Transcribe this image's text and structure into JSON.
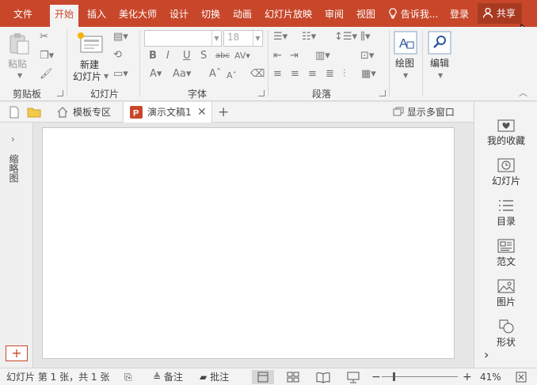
{
  "menu": {
    "items": [
      "文件",
      "开始",
      "插入",
      "美化大师",
      "设计",
      "切换",
      "动画",
      "幻灯片放映",
      "审阅",
      "视图"
    ],
    "active": "开始",
    "tell_me": "告诉我...",
    "login": "登录",
    "share": "共享"
  },
  "ribbon": {
    "clipboard": {
      "paste": "粘贴",
      "label": "剪贴板"
    },
    "slides": {
      "new_slide": "新建",
      "new_slide_2": "幻灯片",
      "label": "幻灯片"
    },
    "font": {
      "font_size": "18",
      "label": "字体"
    },
    "paragraph": {
      "label": "段落"
    },
    "drawing": {
      "label": "绘图"
    },
    "editing": {
      "label": "编辑"
    }
  },
  "tabs": {
    "template_zone": "模板专区",
    "document": "演示文稿1",
    "show_multi_window": "显示多窗口"
  },
  "left_panel": {
    "label": "缩略图"
  },
  "right_panel": {
    "items": [
      {
        "label": "我的收藏",
        "icon": "heart-box-icon"
      },
      {
        "label": "幻灯片",
        "icon": "clock-box-icon"
      },
      {
        "label": "目录",
        "icon": "list-icon"
      },
      {
        "label": "范文",
        "icon": "document-template-icon"
      },
      {
        "label": "图片",
        "icon": "image-icon"
      },
      {
        "label": "形状",
        "icon": "shapes-icon"
      }
    ]
  },
  "status": {
    "slide_info": "幻灯片 第 1 张，共 1 张",
    "notes": "备注",
    "comments": "批注",
    "zoom": "41%",
    "zoom_level": 0.41
  },
  "colors": {
    "accent": "#c8472b",
    "share_bg": "#a83a22",
    "ribbon_bg": "#f3f3f3"
  }
}
